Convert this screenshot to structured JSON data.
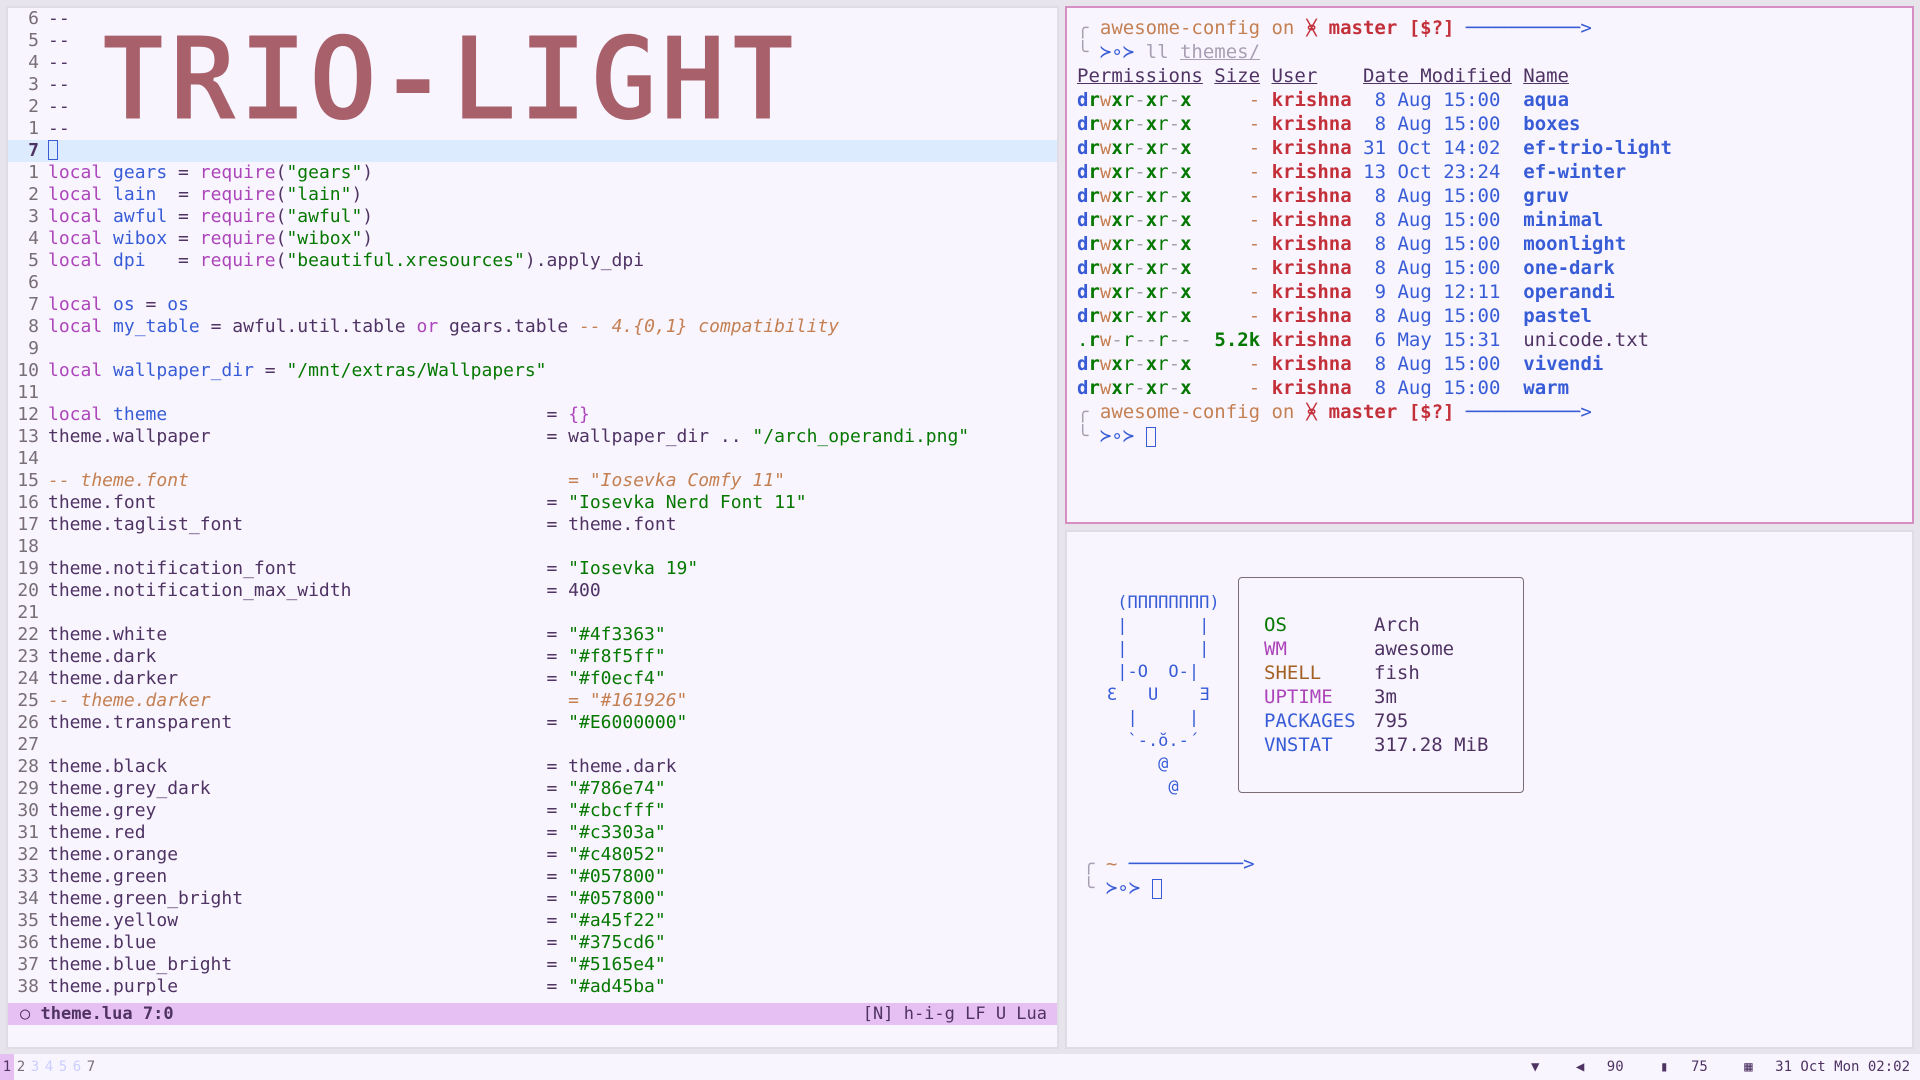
{
  "editor": {
    "banner_text": "TRIO-LIGHT",
    "banner_lines": [
      {
        "num": "6",
        "text": "--"
      },
      {
        "num": "5",
        "text": "--"
      },
      {
        "num": "4",
        "text": "--"
      },
      {
        "num": "3",
        "text": "--"
      },
      {
        "num": "2",
        "text": "--"
      },
      {
        "num": "1",
        "text": "--"
      }
    ],
    "current_line_num": "7",
    "lines": [
      {
        "num": "1",
        "parts": [
          [
            "kw",
            "local"
          ],
          [
            "txt",
            " "
          ],
          [
            "var",
            "gears"
          ],
          [
            "txt",
            " = "
          ],
          [
            "fn",
            "require"
          ],
          [
            "txt",
            "("
          ],
          [
            "str",
            "\"gears\""
          ],
          [
            "txt",
            ")"
          ]
        ]
      },
      {
        "num": "2",
        "parts": [
          [
            "kw",
            "local"
          ],
          [
            "txt",
            " "
          ],
          [
            "var",
            "lain"
          ],
          [
            "txt",
            "  = "
          ],
          [
            "fn",
            "require"
          ],
          [
            "txt",
            "("
          ],
          [
            "str",
            "\"lain\""
          ],
          [
            "txt",
            ")"
          ]
        ]
      },
      {
        "num": "3",
        "parts": [
          [
            "kw",
            "local"
          ],
          [
            "txt",
            " "
          ],
          [
            "var",
            "awful"
          ],
          [
            "txt",
            " = "
          ],
          [
            "fn",
            "require"
          ],
          [
            "txt",
            "("
          ],
          [
            "str",
            "\"awful\""
          ],
          [
            "txt",
            ")"
          ]
        ]
      },
      {
        "num": "4",
        "parts": [
          [
            "kw",
            "local"
          ],
          [
            "txt",
            " "
          ],
          [
            "var",
            "wibox"
          ],
          [
            "txt",
            " = "
          ],
          [
            "fn",
            "require"
          ],
          [
            "txt",
            "("
          ],
          [
            "str",
            "\"wibox\""
          ],
          [
            "txt",
            ")"
          ]
        ]
      },
      {
        "num": "5",
        "parts": [
          [
            "kw",
            "local"
          ],
          [
            "txt",
            " "
          ],
          [
            "var",
            "dpi"
          ],
          [
            "txt",
            "   = "
          ],
          [
            "fn",
            "require"
          ],
          [
            "txt",
            "("
          ],
          [
            "str",
            "\"beautiful.xresources\""
          ],
          [
            "txt",
            ").apply_dpi"
          ]
        ]
      },
      {
        "num": "6",
        "parts": []
      },
      {
        "num": "7",
        "parts": [
          [
            "kw",
            "local"
          ],
          [
            "txt",
            " "
          ],
          [
            "var",
            "os"
          ],
          [
            "txt",
            " = "
          ],
          [
            "var",
            "os"
          ]
        ]
      },
      {
        "num": "8",
        "parts": [
          [
            "kw",
            "local"
          ],
          [
            "txt",
            " "
          ],
          [
            "var",
            "my_table"
          ],
          [
            "txt",
            " = awful.util.table "
          ],
          [
            "kw",
            "or"
          ],
          [
            "txt",
            " gears.table "
          ],
          [
            "cmt",
            "-- 4.{0,1} compatibility"
          ]
        ]
      },
      {
        "num": "9",
        "parts": []
      },
      {
        "num": "10",
        "parts": [
          [
            "kw",
            "local"
          ],
          [
            "txt",
            " "
          ],
          [
            "var",
            "wallpaper_dir"
          ],
          [
            "txt",
            " = "
          ],
          [
            "str",
            "\"/mnt/extras/Wallpapers\""
          ]
        ]
      },
      {
        "num": "11",
        "parts": []
      },
      {
        "num": "12",
        "parts": [
          [
            "kw",
            "local"
          ],
          [
            "txt",
            " "
          ],
          [
            "var",
            "theme"
          ],
          [
            "txt",
            "                                   = "
          ],
          [
            "fn",
            "{}"
          ]
        ]
      },
      {
        "num": "13",
        "parts": [
          [
            "txt",
            "theme.wallpaper                               = wallpaper_dir .. "
          ],
          [
            "str",
            "\"/arch_operandi.png\""
          ]
        ]
      },
      {
        "num": "14",
        "parts": []
      },
      {
        "num": "15",
        "parts": [
          [
            "cmt",
            "-- theme.font                                   = \"Iosevka Comfy 11\""
          ]
        ]
      },
      {
        "num": "16",
        "parts": [
          [
            "txt",
            "theme.font                                    = "
          ],
          [
            "str",
            "\"Iosevka Nerd Font 11\""
          ]
        ]
      },
      {
        "num": "17",
        "parts": [
          [
            "txt",
            "theme.taglist_font                            = theme.font"
          ]
        ]
      },
      {
        "num": "18",
        "parts": []
      },
      {
        "num": "19",
        "parts": [
          [
            "txt",
            "theme.notification_font                       = "
          ],
          [
            "str",
            "\"Iosevka 19\""
          ]
        ]
      },
      {
        "num": "20",
        "parts": [
          [
            "txt",
            "theme.notification_max_width                  = 400"
          ]
        ]
      },
      {
        "num": "21",
        "parts": []
      },
      {
        "num": "22",
        "parts": [
          [
            "txt",
            "theme.white                                   = "
          ],
          [
            "str",
            "\"#4f3363\""
          ]
        ]
      },
      {
        "num": "23",
        "parts": [
          [
            "txt",
            "theme.dark                                    = "
          ],
          [
            "str",
            "\"#f8f5ff\""
          ]
        ]
      },
      {
        "num": "24",
        "parts": [
          [
            "txt",
            "theme.darker                                  = "
          ],
          [
            "str",
            "\"#f0ecf4\""
          ]
        ]
      },
      {
        "num": "25",
        "parts": [
          [
            "cmt",
            "-- theme.darker                                 = \"#161926\""
          ]
        ]
      },
      {
        "num": "26",
        "parts": [
          [
            "txt",
            "theme.transparent                             = "
          ],
          [
            "str",
            "\"#E6000000\""
          ]
        ]
      },
      {
        "num": "27",
        "parts": []
      },
      {
        "num": "28",
        "parts": [
          [
            "txt",
            "theme.black                                   = theme.dark"
          ]
        ]
      },
      {
        "num": "29",
        "parts": [
          [
            "txt",
            "theme.grey_dark                               = "
          ],
          [
            "str",
            "\"#786e74\""
          ]
        ]
      },
      {
        "num": "30",
        "parts": [
          [
            "txt",
            "theme.grey                                    = "
          ],
          [
            "str",
            "\"#cbcfff\""
          ]
        ]
      },
      {
        "num": "31",
        "parts": [
          [
            "txt",
            "theme.red                                     = "
          ],
          [
            "str",
            "\"#c3303a\""
          ]
        ]
      },
      {
        "num": "32",
        "parts": [
          [
            "txt",
            "theme.orange                                  = "
          ],
          [
            "str",
            "\"#c48052\""
          ]
        ]
      },
      {
        "num": "33",
        "parts": [
          [
            "txt",
            "theme.green                                   = "
          ],
          [
            "str",
            "\"#057800\""
          ]
        ]
      },
      {
        "num": "34",
        "parts": [
          [
            "txt",
            "theme.green_bright                            = "
          ],
          [
            "str",
            "\"#057800\""
          ]
        ]
      },
      {
        "num": "35",
        "parts": [
          [
            "txt",
            "theme.yellow                                  = "
          ],
          [
            "str",
            "\"#a45f22\""
          ]
        ]
      },
      {
        "num": "36",
        "parts": [
          [
            "txt",
            "theme.blue                                    = "
          ],
          [
            "str",
            "\"#375cd6\""
          ]
        ]
      },
      {
        "num": "37",
        "parts": [
          [
            "txt",
            "theme.blue_bright                             = "
          ],
          [
            "str",
            "\"#5165e4\""
          ]
        ]
      },
      {
        "num": "38",
        "parts": [
          [
            "txt",
            "theme.purple                                  = "
          ],
          [
            "str",
            "\"#ad45ba\""
          ]
        ]
      }
    ],
    "status": {
      "left": "theme.lua 7:0",
      "right": "[N] h-i-g LF U Lua"
    }
  },
  "term_top": {
    "prompt_dir": "awesome-config",
    "prompt_on": "on",
    "prompt_branch": "ᚸ master [$?]",
    "command_prompt": "≻∘≻",
    "command": "ll",
    "command_arg": "themes/",
    "headers": [
      "Permissions",
      "Size",
      "User",
      "Date Modified",
      "Name"
    ],
    "rows": [
      {
        "perm": "drwxr-xr-x",
        "size": "-",
        "user": "krishna",
        "date": " 8 Aug 15:00",
        "name": "aqua",
        "dir": true
      },
      {
        "perm": "drwxr-xr-x",
        "size": "-",
        "user": "krishna",
        "date": " 8 Aug 15:00",
        "name": "boxes",
        "dir": true
      },
      {
        "perm": "drwxr-xr-x",
        "size": "-",
        "user": "krishna",
        "date": "31 Oct 14:02",
        "name": "ef-trio-light",
        "dir": true
      },
      {
        "perm": "drwxr-xr-x",
        "size": "-",
        "user": "krishna",
        "date": "13 Oct 23:24",
        "name": "ef-winter",
        "dir": true
      },
      {
        "perm": "drwxr-xr-x",
        "size": "-",
        "user": "krishna",
        "date": " 8 Aug 15:00",
        "name": "gruv",
        "dir": true
      },
      {
        "perm": "drwxr-xr-x",
        "size": "-",
        "user": "krishna",
        "date": " 8 Aug 15:00",
        "name": "minimal",
        "dir": true
      },
      {
        "perm": "drwxr-xr-x",
        "size": "-",
        "user": "krishna",
        "date": " 8 Aug 15:00",
        "name": "moonlight",
        "dir": true
      },
      {
        "perm": "drwxr-xr-x",
        "size": "-",
        "user": "krishna",
        "date": " 8 Aug 15:00",
        "name": "one-dark",
        "dir": true
      },
      {
        "perm": "drwxr-xr-x",
        "size": "-",
        "user": "krishna",
        "date": " 9 Aug 12:11",
        "name": "operandi",
        "dir": true
      },
      {
        "perm": "drwxr-xr-x",
        "size": "-",
        "user": "krishna",
        "date": " 8 Aug 15:00",
        "name": "pastel",
        "dir": true
      },
      {
        "perm": ".rw-r--r--",
        "size": "5.2k",
        "user": "krishna",
        "date": " 6 May 15:31",
        "name": "unicode.txt",
        "dir": false
      },
      {
        "perm": "drwxr-xr-x",
        "size": "-",
        "user": "krishna",
        "date": " 8 Aug 15:00",
        "name": "vivendi",
        "dir": true
      },
      {
        "perm": "drwxr-xr-x",
        "size": "-",
        "user": "krishna",
        "date": " 8 Aug 15:00",
        "name": "warm",
        "dir": true
      }
    ]
  },
  "term_bottom": {
    "ascii_art": " (ΠΠΠΠΠΠΠΠ)\n |       |\n |       |\n |-O  O-|\nƐ   U    Ǝ\n  |     |\n  `-.ŏ.-´\n     @\n      @",
    "fetch": [
      {
        "key": "OS",
        "value": "Arch",
        "cls": "k-os"
      },
      {
        "key": "WM",
        "value": "awesome",
        "cls": "k-wm"
      },
      {
        "key": "SHELL",
        "value": "fish",
        "cls": "k-shell"
      },
      {
        "key": "UPTIME",
        "value": "3m",
        "cls": "k-up"
      },
      {
        "key": "PACKAGES",
        "value": "795",
        "cls": "k-pkg"
      },
      {
        "key": "VNSTAT",
        "value": "317.28 MiB",
        "cls": "k-vn"
      }
    ],
    "prompt_dir": "~"
  },
  "bar": {
    "tags": [
      "1",
      "2",
      "3",
      "4",
      "5",
      "6",
      "7"
    ],
    "active_tag": 0,
    "volume": "90",
    "battery": "75",
    "datetime": "31 Oct Mon 02:02"
  }
}
